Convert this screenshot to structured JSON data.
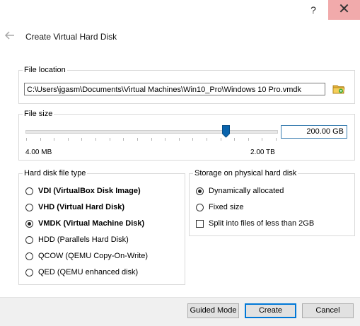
{
  "titlebar": {
    "help_label": "?",
    "close_label": "✕"
  },
  "dialog": {
    "title": "Create Virtual Hard Disk"
  },
  "file_location": {
    "group_label": "File location",
    "path_value": "C:\\Users\\jgasm\\Documents\\Virtual Machines\\Win10_Pro\\Windows 10 Pro.vmdk",
    "folder_icon": "folder-icon"
  },
  "file_size": {
    "group_label": "File size",
    "value": "200.00 GB",
    "min_label": "4.00 MB",
    "max_label": "2.00 TB",
    "slider_fraction": 0.8
  },
  "disk_type": {
    "group_label": "Hard disk file type",
    "options": [
      {
        "label": "VDI (VirtualBox Disk Image)",
        "checked": false,
        "bold": true
      },
      {
        "label": "VHD (Virtual Hard Disk)",
        "checked": false,
        "bold": true
      },
      {
        "label": "VMDK (Virtual Machine Disk)",
        "checked": true,
        "bold": true
      },
      {
        "label": "HDD (Parallels Hard Disk)",
        "checked": false,
        "bold": false
      },
      {
        "label": "QCOW (QEMU Copy-On-Write)",
        "checked": false,
        "bold": false
      },
      {
        "label": "QED (QEMU enhanced disk)",
        "checked": false,
        "bold": false
      }
    ]
  },
  "storage": {
    "group_label": "Storage on physical hard disk",
    "dynamic_label": "Dynamically allocated",
    "fixed_label": "Fixed size",
    "split_label": "Split into files of less than 2GB",
    "selected": "dynamic",
    "split_checked": false
  },
  "buttons": {
    "guided_mode": "Guided Mode",
    "create": "Create",
    "cancel": "Cancel"
  },
  "colors": {
    "accent": "#0078d7",
    "close_bg": "#f1aaab",
    "slider_thumb": "#0a64ad"
  }
}
